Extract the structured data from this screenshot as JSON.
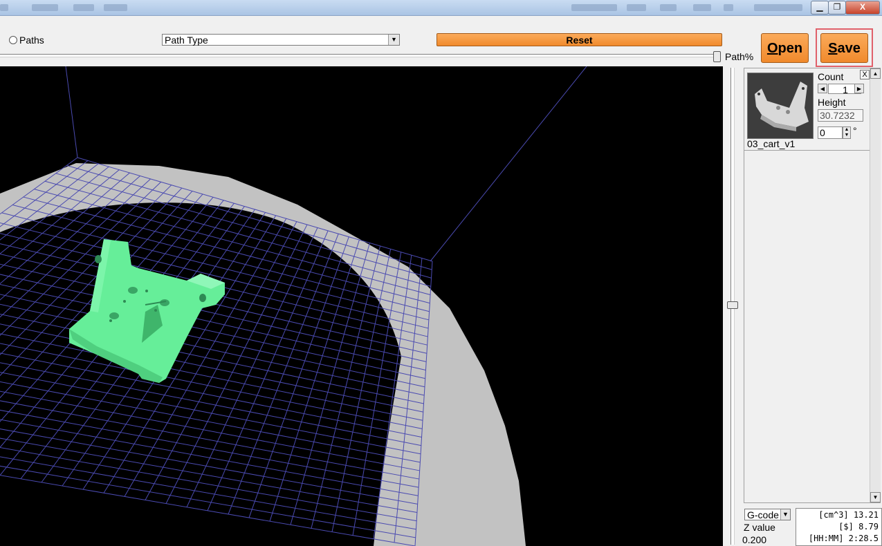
{
  "window": {
    "minimize_icon": "minimize-icon",
    "maximize_icon": "restore-icon",
    "close_icon": "close-icon",
    "close_label": "X"
  },
  "toolbar": {
    "paths_label": "Paths",
    "path_type": {
      "selected": "Path Type"
    },
    "reset_label": "Reset",
    "path_percent_label": "Path%",
    "open_label": "Open",
    "open_hotkey": "O",
    "open_rest": "pen",
    "save_label": "Save",
    "save_hotkey": "S",
    "save_rest": "ave",
    "accent_color": "#f39233"
  },
  "panel": {
    "close_label": "X",
    "count_label": "Count",
    "count_value": "1",
    "height_label": "Height",
    "height_value": "30.7232",
    "rotation_value": "0",
    "degree_symbol": "°",
    "model_name": "03_cart_v1"
  },
  "bottom": {
    "format": {
      "selected": "G-code"
    },
    "z_label": "Z value",
    "z_value": "0.200",
    "stats": [
      {
        "text": "[cm^3] 13.21"
      },
      {
        "text": "[$] 8.79"
      },
      {
        "text": "[HH:MM] 2:28.5"
      }
    ]
  },
  "colors": {
    "model": "#66ee99",
    "bed": "#c2c2c2",
    "grid": "#4a4ab0",
    "background": "#000000",
    "highlight": "#e0606a"
  }
}
